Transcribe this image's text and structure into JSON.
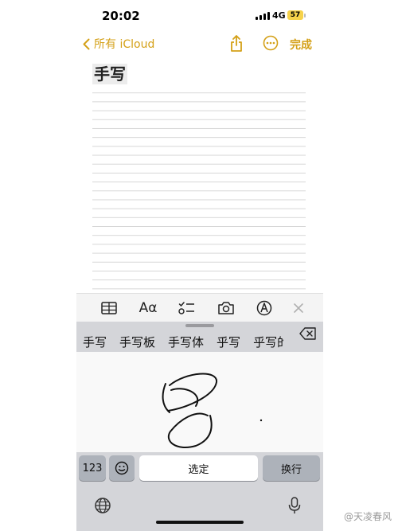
{
  "status": {
    "time": "20:02",
    "network": "4G",
    "battery": "57"
  },
  "nav": {
    "back_label": "所有 iCloud",
    "done_label": "完成"
  },
  "note": {
    "title": "手写"
  },
  "toolbar": {
    "format_label": "Aα"
  },
  "keyboard": {
    "candidates": [
      "手写",
      "手写板",
      "手写体",
      "乎写",
      "乎写的"
    ],
    "key_123": "123",
    "space_label": "选定",
    "return_label": "换行"
  },
  "watermark": "@天凌春风",
  "colors": {
    "accent": "#d4a017",
    "keyboard_bg": "#d4d5d9",
    "key_dark": "#adb2ba"
  }
}
